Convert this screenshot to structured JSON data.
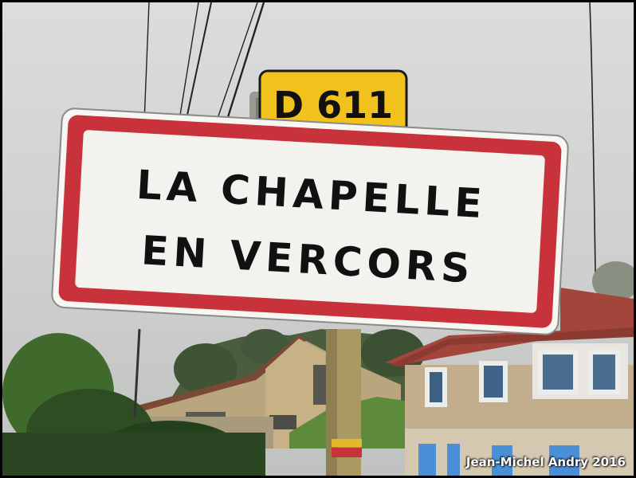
{
  "route_plate": {
    "text": "D 611",
    "color": "#f2c21c"
  },
  "town_sign": {
    "line1": "LA CHAPELLE",
    "line2": "EN VERCORS",
    "border_color": "#c8323a",
    "background_color": "#f3f2ee"
  },
  "credit": "Jean-Michel Andry 2016"
}
